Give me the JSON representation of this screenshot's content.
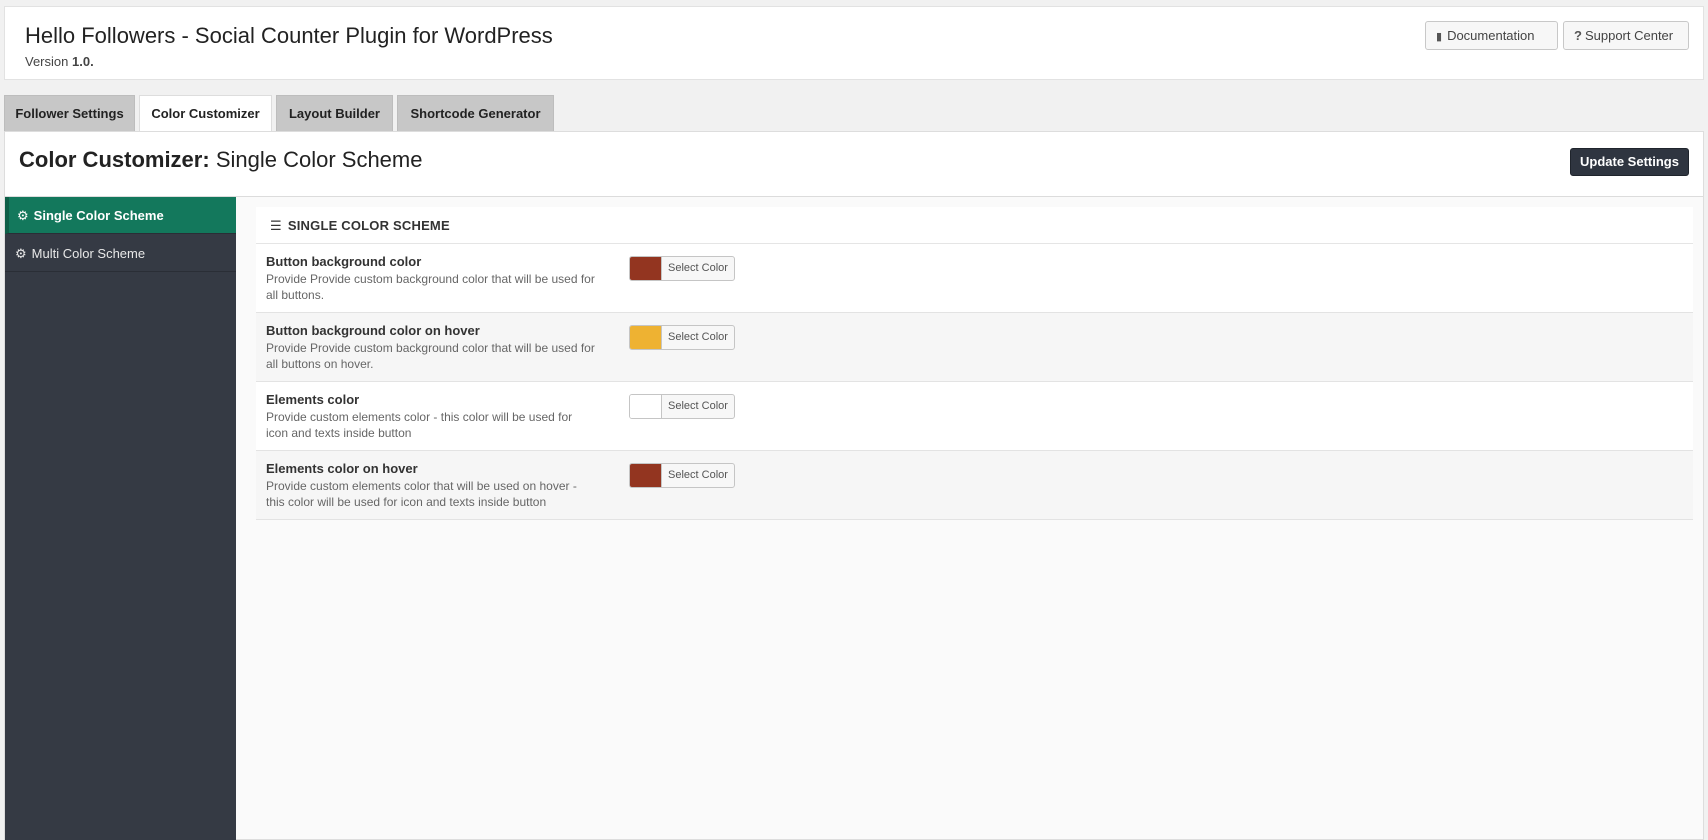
{
  "header": {
    "title": "Hello Followers - Social Counter Plugin for WordPress",
    "version_prefix": "Version",
    "version": "1.0.",
    "documentation_label": "Documentation",
    "documentation_icon": "book-icon",
    "support_label": "Support Center",
    "support_icon": "question-icon"
  },
  "tabs": [
    {
      "label": "Follower Settings",
      "active": false
    },
    {
      "label": "Color Customizer",
      "active": true
    },
    {
      "label": "Layout Builder",
      "active": false
    },
    {
      "label": "Shortcode Generator",
      "active": false
    }
  ],
  "panel": {
    "title_strong": "Color Customizer:",
    "title_rest": "Single Color Scheme",
    "update_label": "Update Settings"
  },
  "sidebar": {
    "items": [
      {
        "label": "Single Color Scheme",
        "icon": "gear-icon",
        "active": true
      },
      {
        "label": "Multi Color Scheme",
        "icon": "gear-icon",
        "active": false
      }
    ]
  },
  "section": {
    "heading": "SINGLE COLOR SCHEME",
    "icon": "bars-icon"
  },
  "settings": [
    {
      "label": "Button background color",
      "description": "Provide Provide custom background color that will be used for all buttons.",
      "color": "#933520",
      "button_label": "Select Color"
    },
    {
      "label": "Button background color on hover",
      "description": "Provide Provide custom background color that will be used for all buttons on hover.",
      "color": "#eeb232",
      "button_label": "Select Color"
    },
    {
      "label": "Elements color",
      "description": "Provide custom elements color - this color will be used for icon and texts inside button",
      "color": "#ffffff",
      "button_label": "Select Color"
    },
    {
      "label": "Elements color on hover",
      "description": "Provide custom elements color that will be used on hover - this color will be used for icon and texts inside button",
      "color": "#933520",
      "button_label": "Select Color"
    }
  ],
  "colors": {
    "accent": "#13785c",
    "sidebar_bg": "#353a44",
    "update_button_bg": "#2f3540"
  }
}
